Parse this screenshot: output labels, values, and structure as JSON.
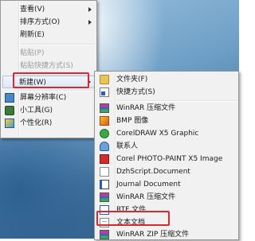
{
  "context_menu": {
    "items": [
      {
        "label": "查看(V)",
        "has_submenu": true
      },
      {
        "label": "排序方式(O)",
        "has_submenu": true
      },
      {
        "label": "刷新(E)"
      },
      {
        "label": "粘贴(P)",
        "disabled": true
      },
      {
        "label": "粘贴快捷方式(S)",
        "disabled": true
      },
      {
        "label": "新建(W)",
        "has_submenu": true,
        "highlighted": true
      },
      {
        "label": "屏幕分辨率(C)",
        "icon": "display-icon"
      },
      {
        "label": "小工具(G)",
        "icon": "gadget-icon"
      },
      {
        "label": "个性化(R)",
        "icon": "personalize-icon"
      }
    ]
  },
  "new_submenu": {
    "items": [
      {
        "label": "文件夹(F)",
        "icon": "folder-icon"
      },
      {
        "label": "快捷方式(S)",
        "icon": "shortcut-icon"
      },
      {
        "label": "WinRAR 压缩文件",
        "icon": "winrar-icon"
      },
      {
        "label": "BMP 图像",
        "icon": "bmp-image-icon"
      },
      {
        "label": "CorelDRAW X5 Graphic",
        "icon": "coreldraw-icon"
      },
      {
        "label": "联系人",
        "icon": "contact-icon"
      },
      {
        "label": "Corel PHOTO-PAINT X5 Image",
        "icon": "photo-paint-icon"
      },
      {
        "label": "DzhScript.Document",
        "icon": "document-icon"
      },
      {
        "label": "Journal Document",
        "icon": "journal-icon"
      },
      {
        "label": "WinRAR 压缩文件",
        "icon": "winrar-icon"
      },
      {
        "label": "RTF 文件",
        "icon": "rtf-icon"
      },
      {
        "label": "文本文档",
        "icon": "text-document-icon",
        "highlighted": true
      },
      {
        "label": "WinRAR ZIP 压缩文件",
        "icon": "winrar-zip-icon"
      }
    ]
  },
  "colors": {
    "highlight_box": "#e0252f",
    "menu_background": "#f1f1f1"
  }
}
